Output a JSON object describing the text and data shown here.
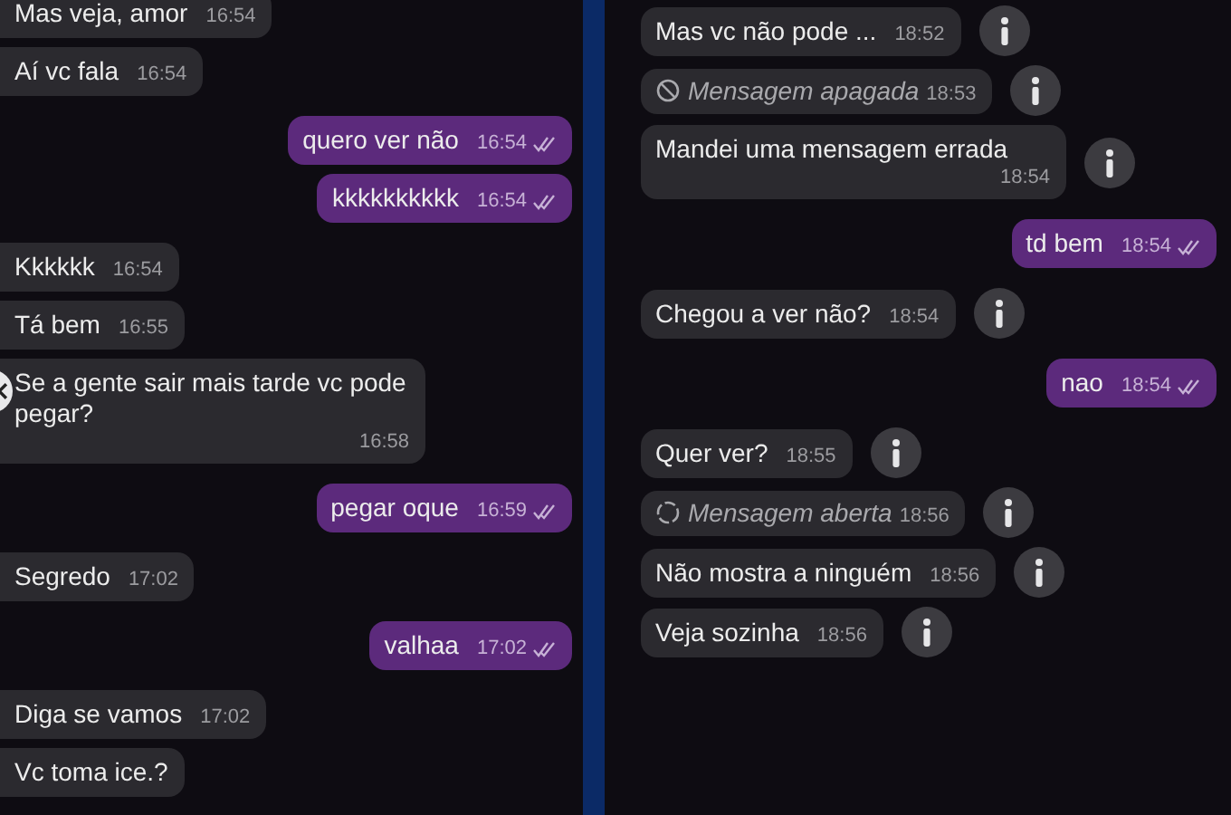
{
  "left_chat": {
    "messages": [
      {
        "kind": "incoming",
        "text": "Mas veja, amor",
        "time": "16:54"
      },
      {
        "kind": "incoming",
        "text": "Aí vc fala",
        "time": "16:54"
      },
      {
        "kind": "outgoing",
        "text": "quero ver não",
        "time": "16:54"
      },
      {
        "kind": "outgoing",
        "text": "kkkkkkkkkk",
        "time": "16:54"
      },
      {
        "kind": "incoming",
        "text": "Kkkkkk",
        "time": "16:54"
      },
      {
        "kind": "incoming",
        "text": "Tá bem",
        "time": "16:55"
      },
      {
        "kind": "incoming",
        "text": "Se a gente sair mais tarde vc pode pegar?",
        "time": "16:58"
      },
      {
        "kind": "outgoing",
        "text": "pegar oque",
        "time": "16:59"
      },
      {
        "kind": "incoming",
        "text": "Segredo",
        "time": "17:02"
      },
      {
        "kind": "outgoing",
        "text": "valhaa",
        "time": "17:02"
      },
      {
        "kind": "incoming",
        "text": "Diga se vamos",
        "time": "17:02"
      },
      {
        "kind": "incoming",
        "text": "Vc toma ice.?"
      }
    ]
  },
  "right_chat": {
    "messages": [
      {
        "kind": "incoming",
        "text": "Mas vc não pode ...",
        "time": "18:52",
        "info_button": true
      },
      {
        "kind": "deleted",
        "text": "Mensagem apagada",
        "time": "18:53",
        "info_button": true
      },
      {
        "kind": "incoming",
        "text": "Mandei uma mensagem errada",
        "time": "18:54",
        "info_button": true
      },
      {
        "kind": "outgoing",
        "text": "td bem",
        "time": "18:54"
      },
      {
        "kind": "incoming",
        "text": "Chegou a ver não?",
        "time": "18:54",
        "info_button": true
      },
      {
        "kind": "outgoing",
        "text": "nao",
        "time": "18:54"
      },
      {
        "kind": "incoming",
        "text": "Quer ver?",
        "time": "18:55",
        "info_button": true
      },
      {
        "kind": "opened",
        "text": "Mensagem aberta",
        "time": "18:56",
        "info_button": true
      },
      {
        "kind": "incoming",
        "text": "Não mostra a ninguém",
        "time": "18:56",
        "info_button": true
      },
      {
        "kind": "incoming",
        "text": "Veja sozinha",
        "time": "18:56",
        "info_button": true
      }
    ]
  }
}
